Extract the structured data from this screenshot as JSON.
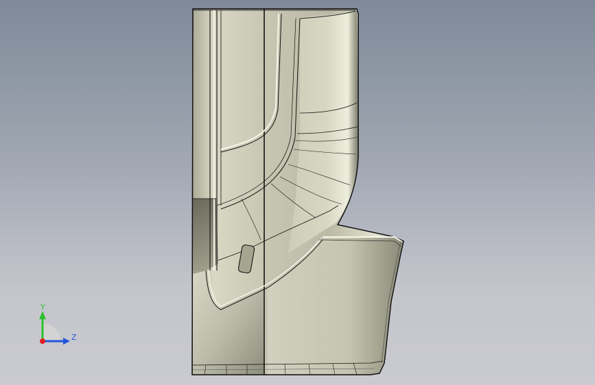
{
  "viewport": {
    "background_top": "#7e8a99",
    "background_bottom": "#cacbd0"
  },
  "model": {
    "name": "part-side-view",
    "face_color": "#c9c9b6",
    "edge_color": "#111111"
  },
  "triad": {
    "y_label": "Y",
    "z_label": "Z",
    "y_color": "#2ec02e",
    "z_color": "#2255dd",
    "x_color": "#dd2222"
  }
}
